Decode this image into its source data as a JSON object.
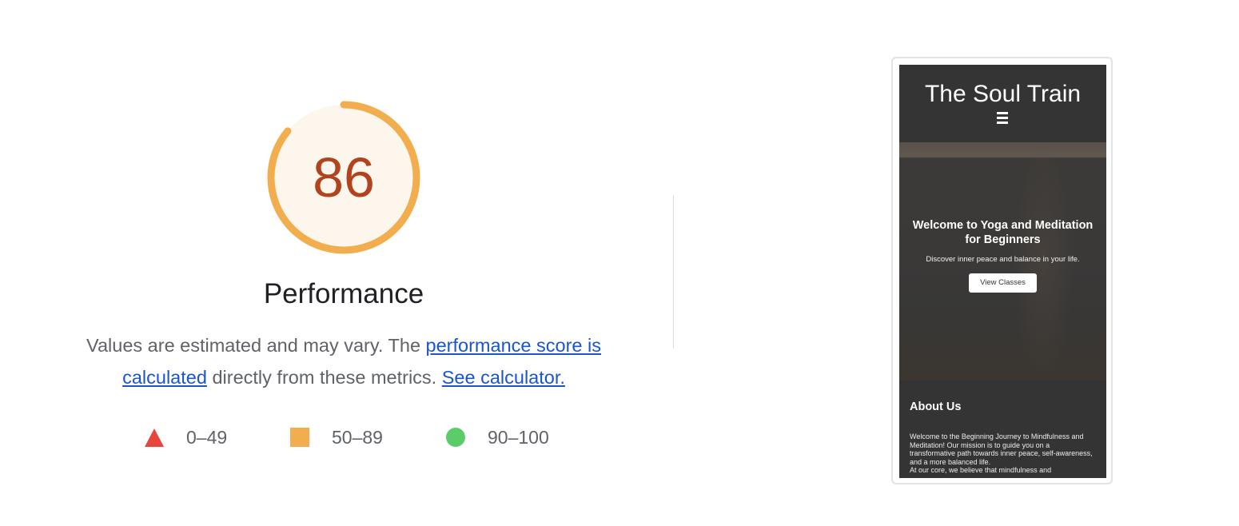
{
  "performance": {
    "score": "86",
    "score_fraction": 0.86,
    "title": "Performance",
    "description_start": "Values are estimated and may vary. The ",
    "score_link": "performance score is calculated",
    "description_middle": " directly from these metrics. ",
    "calculator_link": "See calculator.",
    "colors": {
      "score_text": "#b1431f",
      "arc": "#f2ad4f",
      "fill": "#fdf6ec",
      "link": "#1a56c9"
    }
  },
  "legend": [
    {
      "icon": "triangle-icon",
      "range": "0–49",
      "color": "#e8453c"
    },
    {
      "icon": "square-icon",
      "range": "50–89",
      "color": "#f2ad4f"
    },
    {
      "icon": "circle-icon",
      "range": "90–100",
      "color": "#5ccc6b"
    }
  ],
  "preview": {
    "site_title": "The Soul Train",
    "menu_icon": "hamburger-menu-icon",
    "hero_title": "Welcome to Yoga and Meditation for Beginners",
    "hero_subtitle": "Discover inner peace and balance in your life.",
    "hero_button": "View Classes",
    "about_title": "About Us",
    "about_text_1": "Welcome to the Beginning Journey to Mindfulness and Meditation! Our mission is to guide you on a transformative path towards inner peace, self-awareness, and a more balanced life.",
    "about_text_2": "At our core, we believe that mindfulness and"
  }
}
